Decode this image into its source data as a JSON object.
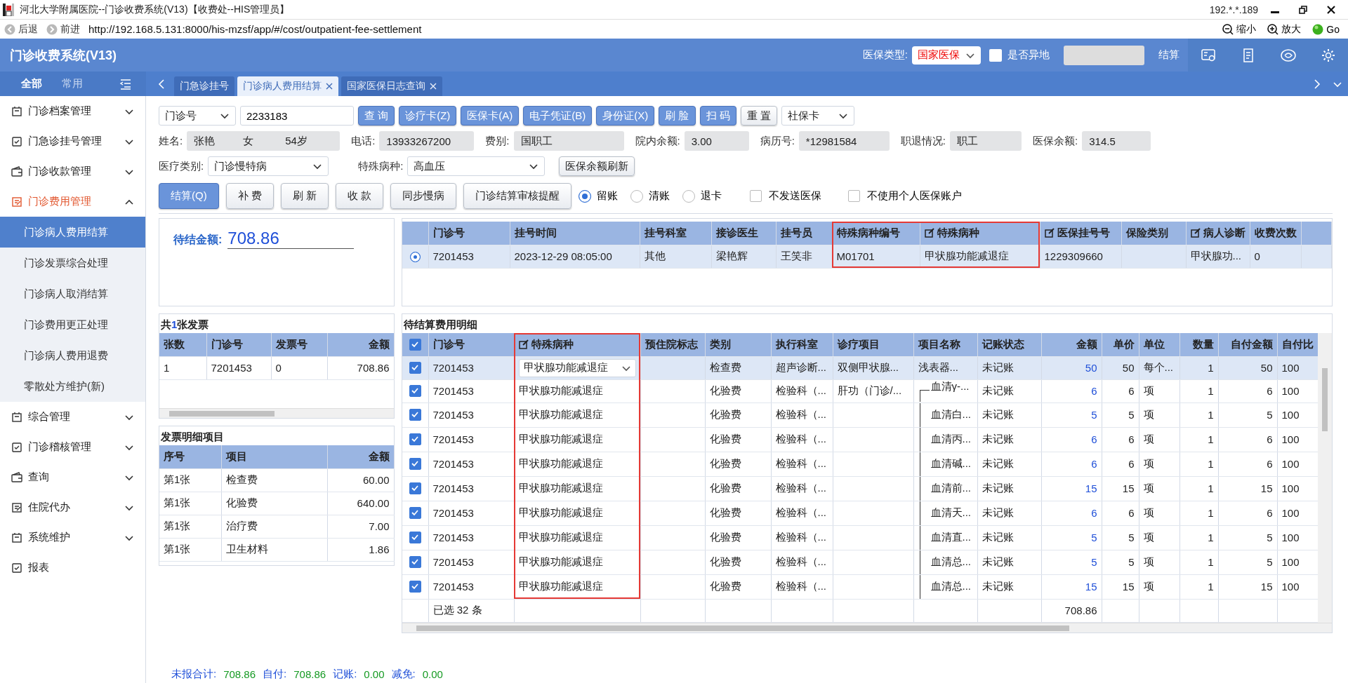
{
  "window": {
    "title": "河北大学附属医院--门诊收费系统(V13)【收费处--HIS管理员】",
    "ip": "192.*.*.189"
  },
  "browser": {
    "back": "后退",
    "forward": "前进",
    "url": "http://192.168.5.131:8000/his-mzsf/app/#/cost/outpatient-fee-settlement",
    "zoom_out": "缩小",
    "zoom_in": "放大",
    "go": "Go"
  },
  "app_header": {
    "title": "门诊收费系统(V13)",
    "insurance_type_label": "医保类型:",
    "insurance_type": "国家医保",
    "remote_label": "是否异地",
    "remote_checked": false,
    "settle_button": "结算"
  },
  "sidebar": {
    "tabs": [
      {
        "label": "全部",
        "selected": true
      },
      {
        "label": "常用",
        "selected": false
      }
    ],
    "items": [
      {
        "label": "门诊档案管理",
        "kind": "group",
        "expanded": false
      },
      {
        "label": "门急诊挂号管理",
        "kind": "group",
        "expanded": false
      },
      {
        "label": "门诊收款管理",
        "kind": "group",
        "expanded": false
      },
      {
        "label": "门诊费用管理",
        "kind": "group",
        "expanded": true,
        "children": [
          {
            "label": "门诊病人费用结算",
            "selected": true
          },
          {
            "label": "门诊发票综合处理",
            "selected": false
          },
          {
            "label": "门诊病人取消结算",
            "selected": false
          },
          {
            "label": "门诊费用更正处理",
            "selected": false
          },
          {
            "label": "门诊病人费用退费",
            "selected": false
          },
          {
            "label": "零散处方维护(新)",
            "selected": false
          }
        ]
      },
      {
        "label": "综合管理",
        "kind": "group",
        "expanded": false
      },
      {
        "label": "门诊稽核管理",
        "kind": "group",
        "expanded": false
      },
      {
        "label": "查询",
        "kind": "group",
        "expanded": false
      },
      {
        "label": "住院代办",
        "kind": "group",
        "expanded": false
      },
      {
        "label": "系统维护",
        "kind": "group",
        "expanded": false
      },
      {
        "label": "报表",
        "kind": "link",
        "expanded": false
      }
    ]
  },
  "tabs": [
    {
      "label": "门急诊挂号",
      "selected": false,
      "closable": false
    },
    {
      "label": "门诊病人费用结算",
      "selected": true,
      "closable": true
    },
    {
      "label": "国家医保日志查询",
      "selected": false,
      "closable": true
    }
  ],
  "search": {
    "type": "门诊号",
    "value": "2233183",
    "card_type": "社保卡",
    "buttons": [
      {
        "label": "查 询",
        "kind": "primary"
      },
      {
        "label": "诊疗卡(Z)",
        "kind": "primary"
      },
      {
        "label": "医保卡(A)",
        "kind": "primary"
      },
      {
        "label": "电子凭证(B)",
        "kind": "primary"
      },
      {
        "label": "身份证(X)",
        "kind": "primary"
      },
      {
        "label": "刷 脸",
        "kind": "primary"
      },
      {
        "label": "扫 码",
        "kind": "primary"
      },
      {
        "label": "重 置",
        "kind": "default"
      }
    ]
  },
  "patient": {
    "fields": [
      {
        "label": "姓名:",
        "values": [
          "张艳",
          "女",
          "54岁"
        ]
      },
      {
        "label": "电话:",
        "values": [
          "13933267200"
        ]
      },
      {
        "label": "费别:",
        "values": [
          "国职工"
        ]
      },
      {
        "label": "院内余额:",
        "values": [
          "3.00"
        ]
      },
      {
        "label": "病历号:",
        "values": [
          "*12981584"
        ]
      },
      {
        "label": "职退情况:",
        "values": [
          "职工"
        ]
      },
      {
        "label": "医保余额:",
        "values": [
          "314.5"
        ]
      }
    ]
  },
  "filters": {
    "medical_category_label": "医疗类别:",
    "medical_category": "门诊慢特病",
    "disease_label": "特殊病种:",
    "disease": "高血压",
    "refresh_button": "医保余额刷新"
  },
  "actions": {
    "buttons": [
      {
        "label": "结算(Q)",
        "kind": "primary"
      },
      {
        "label": "补 费",
        "kind": "default"
      },
      {
        "label": "刷 新",
        "kind": "default"
      },
      {
        "label": "收 款",
        "kind": "default"
      },
      {
        "label": "同步慢病",
        "kind": "default"
      },
      {
        "label": "门诊结算审核提醒",
        "kind": "default"
      }
    ],
    "radios": [
      {
        "label": "留账",
        "selected": true
      },
      {
        "label": "清账",
        "selected": false
      },
      {
        "label": "退卡",
        "selected": false
      }
    ],
    "checkboxes": [
      {
        "label": "不发送医保",
        "checked": false
      },
      {
        "label": "不使用个人医保账户",
        "checked": false
      }
    ]
  },
  "pending": {
    "label": "待结金额:",
    "amount": "708.86"
  },
  "registrations": {
    "columns": [
      {
        "title": "门诊号",
        "editable": false,
        "highlighted": false
      },
      {
        "title": "挂号时间",
        "editable": false,
        "highlighted": false
      },
      {
        "title": "挂号科室",
        "editable": false,
        "highlighted": false
      },
      {
        "title": "接诊医生",
        "editable": false,
        "highlighted": false
      },
      {
        "title": "挂号员",
        "editable": false,
        "highlighted": false
      },
      {
        "title": "特殊病种编号",
        "editable": false,
        "highlighted": true
      },
      {
        "title": "特殊病种",
        "editable": true,
        "highlighted": true
      },
      {
        "title": "医保挂号号",
        "editable": true,
        "highlighted": false
      },
      {
        "title": "保险类别",
        "editable": false,
        "highlighted": false
      },
      {
        "title": "病人诊断",
        "editable": true,
        "highlighted": false
      },
      {
        "title": "收费次数",
        "editable": false,
        "highlighted": false
      }
    ],
    "rows": [
      {
        "selected": true,
        "cells": [
          "7201453",
          "2023-12-29 08:05:00",
          "其他",
          "梁艳辉",
          "王笑非",
          "M01701",
          "甲状腺功能减退症",
          "1229309660",
          "",
          "甲状腺功...",
          "0"
        ]
      }
    ]
  },
  "invoices": {
    "summary": {
      "prefix": "共",
      "count": "1",
      "suffix": "张发票"
    },
    "columns": [
      {
        "title": "张数"
      },
      {
        "title": "门诊号"
      },
      {
        "title": "发票号"
      },
      {
        "title": "金额"
      }
    ],
    "rows": [
      [
        "1",
        "7201453",
        "0",
        "708.86"
      ]
    ]
  },
  "invoice_items": {
    "title": "发票明细项目",
    "columns": [
      {
        "title": "序号"
      },
      {
        "title": "项目"
      },
      {
        "title": "金额"
      }
    ],
    "rows": [
      [
        "第1张",
        "检查费",
        "60.00"
      ],
      [
        "第1张",
        "化验费",
        "640.00"
      ],
      [
        "第1张",
        "治疗费",
        "7.00"
      ],
      [
        "第1张",
        "卫生材料",
        "1.86"
      ]
    ]
  },
  "details": {
    "title": "待结算费用明细",
    "all_checked": true,
    "columns": [
      {
        "title": "门诊号",
        "editable": false,
        "highlighted": false
      },
      {
        "title": "特殊病种",
        "editable": true,
        "highlighted": true
      },
      {
        "title": "预住院标志",
        "editable": false,
        "highlighted": false
      },
      {
        "title": "类别",
        "editable": false,
        "highlighted": false
      },
      {
        "title": "执行科室",
        "editable": false,
        "highlighted": false
      },
      {
        "title": "诊疗项目",
        "editable": false,
        "highlighted": false
      },
      {
        "title": "项目名称",
        "editable": false,
        "highlighted": false
      },
      {
        "title": "记账状态",
        "editable": false,
        "highlighted": false
      },
      {
        "title": "金额",
        "editable": false,
        "highlighted": false
      },
      {
        "title": "单价",
        "editable": false,
        "highlighted": false
      },
      {
        "title": "单位",
        "editable": false,
        "highlighted": false
      },
      {
        "title": "数量",
        "editable": false,
        "highlighted": false
      },
      {
        "title": "自付金额",
        "editable": false,
        "highlighted": false
      },
      {
        "title": "自付比",
        "editable": false,
        "highlighted": false
      }
    ],
    "rows": [
      {
        "checked": true,
        "selected": true,
        "editing": true,
        "grouped": false,
        "cells": [
          "7201453",
          "甲状腺功能减退症",
          "",
          "检查费",
          "超声诊断...",
          "双侧甲状腺...",
          "浅表器...",
          "未记账",
          "50",
          "50",
          "每个...",
          "1",
          "50",
          "100"
        ]
      },
      {
        "checked": true,
        "selected": false,
        "editing": false,
        "grouped": true,
        "cells": [
          "7201453",
          "甲状腺功能减退症",
          "",
          "化验费",
          "检验科（...",
          "肝功（门诊/...",
          "血清γ-...",
          "未记账",
          "6",
          "6",
          "项",
          "1",
          "6",
          "100"
        ]
      },
      {
        "checked": true,
        "selected": false,
        "editing": false,
        "grouped": true,
        "cells": [
          "7201453",
          "甲状腺功能减退症",
          "",
          "化验费",
          "检验科（...",
          "",
          "血清白...",
          "未记账",
          "5",
          "5",
          "项",
          "1",
          "5",
          "100"
        ]
      },
      {
        "checked": true,
        "selected": false,
        "editing": false,
        "grouped": true,
        "cells": [
          "7201453",
          "甲状腺功能减退症",
          "",
          "化验费",
          "检验科（...",
          "",
          "血清丙...",
          "未记账",
          "6",
          "6",
          "项",
          "1",
          "6",
          "100"
        ]
      },
      {
        "checked": true,
        "selected": false,
        "editing": false,
        "grouped": true,
        "cells": [
          "7201453",
          "甲状腺功能减退症",
          "",
          "化验费",
          "检验科（...",
          "",
          "血清碱...",
          "未记账",
          "6",
          "6",
          "项",
          "1",
          "6",
          "100"
        ]
      },
      {
        "checked": true,
        "selected": false,
        "editing": false,
        "grouped": true,
        "cells": [
          "7201453",
          "甲状腺功能减退症",
          "",
          "化验费",
          "检验科（...",
          "",
          "血清前...",
          "未记账",
          "15",
          "15",
          "项",
          "1",
          "15",
          "100"
        ]
      },
      {
        "checked": true,
        "selected": false,
        "editing": false,
        "grouped": true,
        "cells": [
          "7201453",
          "甲状腺功能减退症",
          "",
          "化验费",
          "检验科（...",
          "",
          "血清天...",
          "未记账",
          "6",
          "6",
          "项",
          "1",
          "6",
          "100"
        ]
      },
      {
        "checked": true,
        "selected": false,
        "editing": false,
        "grouped": true,
        "cells": [
          "7201453",
          "甲状腺功能减退症",
          "",
          "化验费",
          "检验科（...",
          "",
          "血清直...",
          "未记账",
          "5",
          "5",
          "项",
          "1",
          "5",
          "100"
        ]
      },
      {
        "checked": true,
        "selected": false,
        "editing": false,
        "grouped": true,
        "cells": [
          "7201453",
          "甲状腺功能减退症",
          "",
          "化验费",
          "检验科（...",
          "",
          "血清总...",
          "未记账",
          "5",
          "5",
          "项",
          "1",
          "5",
          "100"
        ]
      },
      {
        "checked": true,
        "selected": false,
        "editing": false,
        "grouped": true,
        "cells": [
          "7201453",
          "甲状腺功能减退症",
          "",
          "化验费",
          "检验科（...",
          "",
          "血清总...",
          "未记账",
          "15",
          "15",
          "项",
          "1",
          "15",
          "100"
        ]
      }
    ],
    "footer": {
      "selected_count": "已选 32 条",
      "total": "708.86"
    }
  },
  "totals": [
    {
      "label": "未报合计:",
      "value": "708.86"
    },
    {
      "label": "自付:",
      "value": "708.86"
    },
    {
      "label": "记账:",
      "value": "0.00"
    },
    {
      "label": "减免:",
      "value": "0.00"
    }
  ]
}
